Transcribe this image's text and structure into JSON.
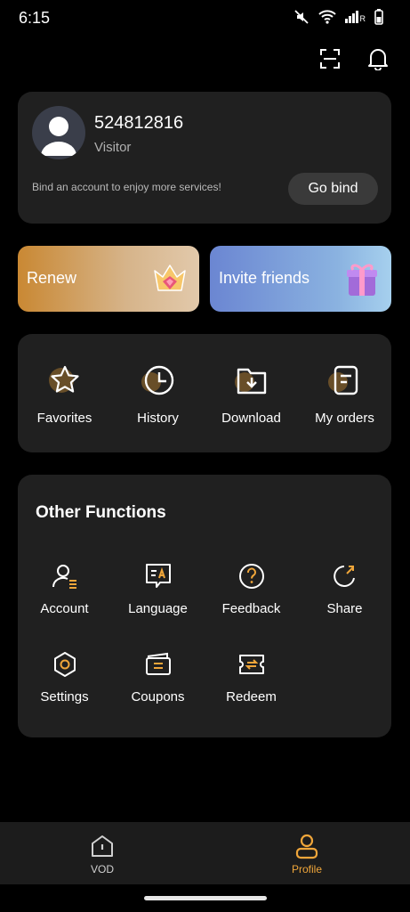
{
  "status_bar": {
    "time": "6:15",
    "icons": [
      "mute-icon",
      "wifi-icon",
      "signal-icon",
      "battery-icon"
    ],
    "signal_label": "R"
  },
  "top_actions": {
    "icons": [
      "scan-icon",
      "bell-icon"
    ]
  },
  "profile": {
    "user_id": "524812816",
    "role": "Visitor",
    "bind_prompt": "Bind an account to enjoy more services!",
    "bind_button": "Go bind"
  },
  "promos": {
    "renew": "Renew",
    "invite": "Invite friends"
  },
  "quick_actions": [
    {
      "label": "Favorites",
      "icon": "star-icon"
    },
    {
      "label": "History",
      "icon": "clock-icon"
    },
    {
      "label": "Download",
      "icon": "download-folder-icon"
    },
    {
      "label": "My orders",
      "icon": "orders-icon"
    }
  ],
  "other_functions": {
    "title": "Other Functions",
    "items": [
      {
        "label": "Account",
        "icon": "account-icon"
      },
      {
        "label": "Language",
        "icon": "language-icon"
      },
      {
        "label": "Feedback",
        "icon": "feedback-icon"
      },
      {
        "label": "Share",
        "icon": "share-icon"
      },
      {
        "label": "Settings",
        "icon": "settings-icon"
      },
      {
        "label": "Coupons",
        "icon": "coupons-icon"
      },
      {
        "label": "Redeem",
        "icon": "redeem-icon"
      }
    ]
  },
  "bottom_nav": {
    "items": [
      {
        "label": "VOD",
        "icon": "home-icon"
      },
      {
        "label": "Profile",
        "icon": "profile-icon",
        "active": true
      }
    ]
  },
  "colors": {
    "background": "#000000",
    "card": "#202020",
    "accent": "#f0a63a",
    "text_secondary": "#b0b0b0"
  }
}
